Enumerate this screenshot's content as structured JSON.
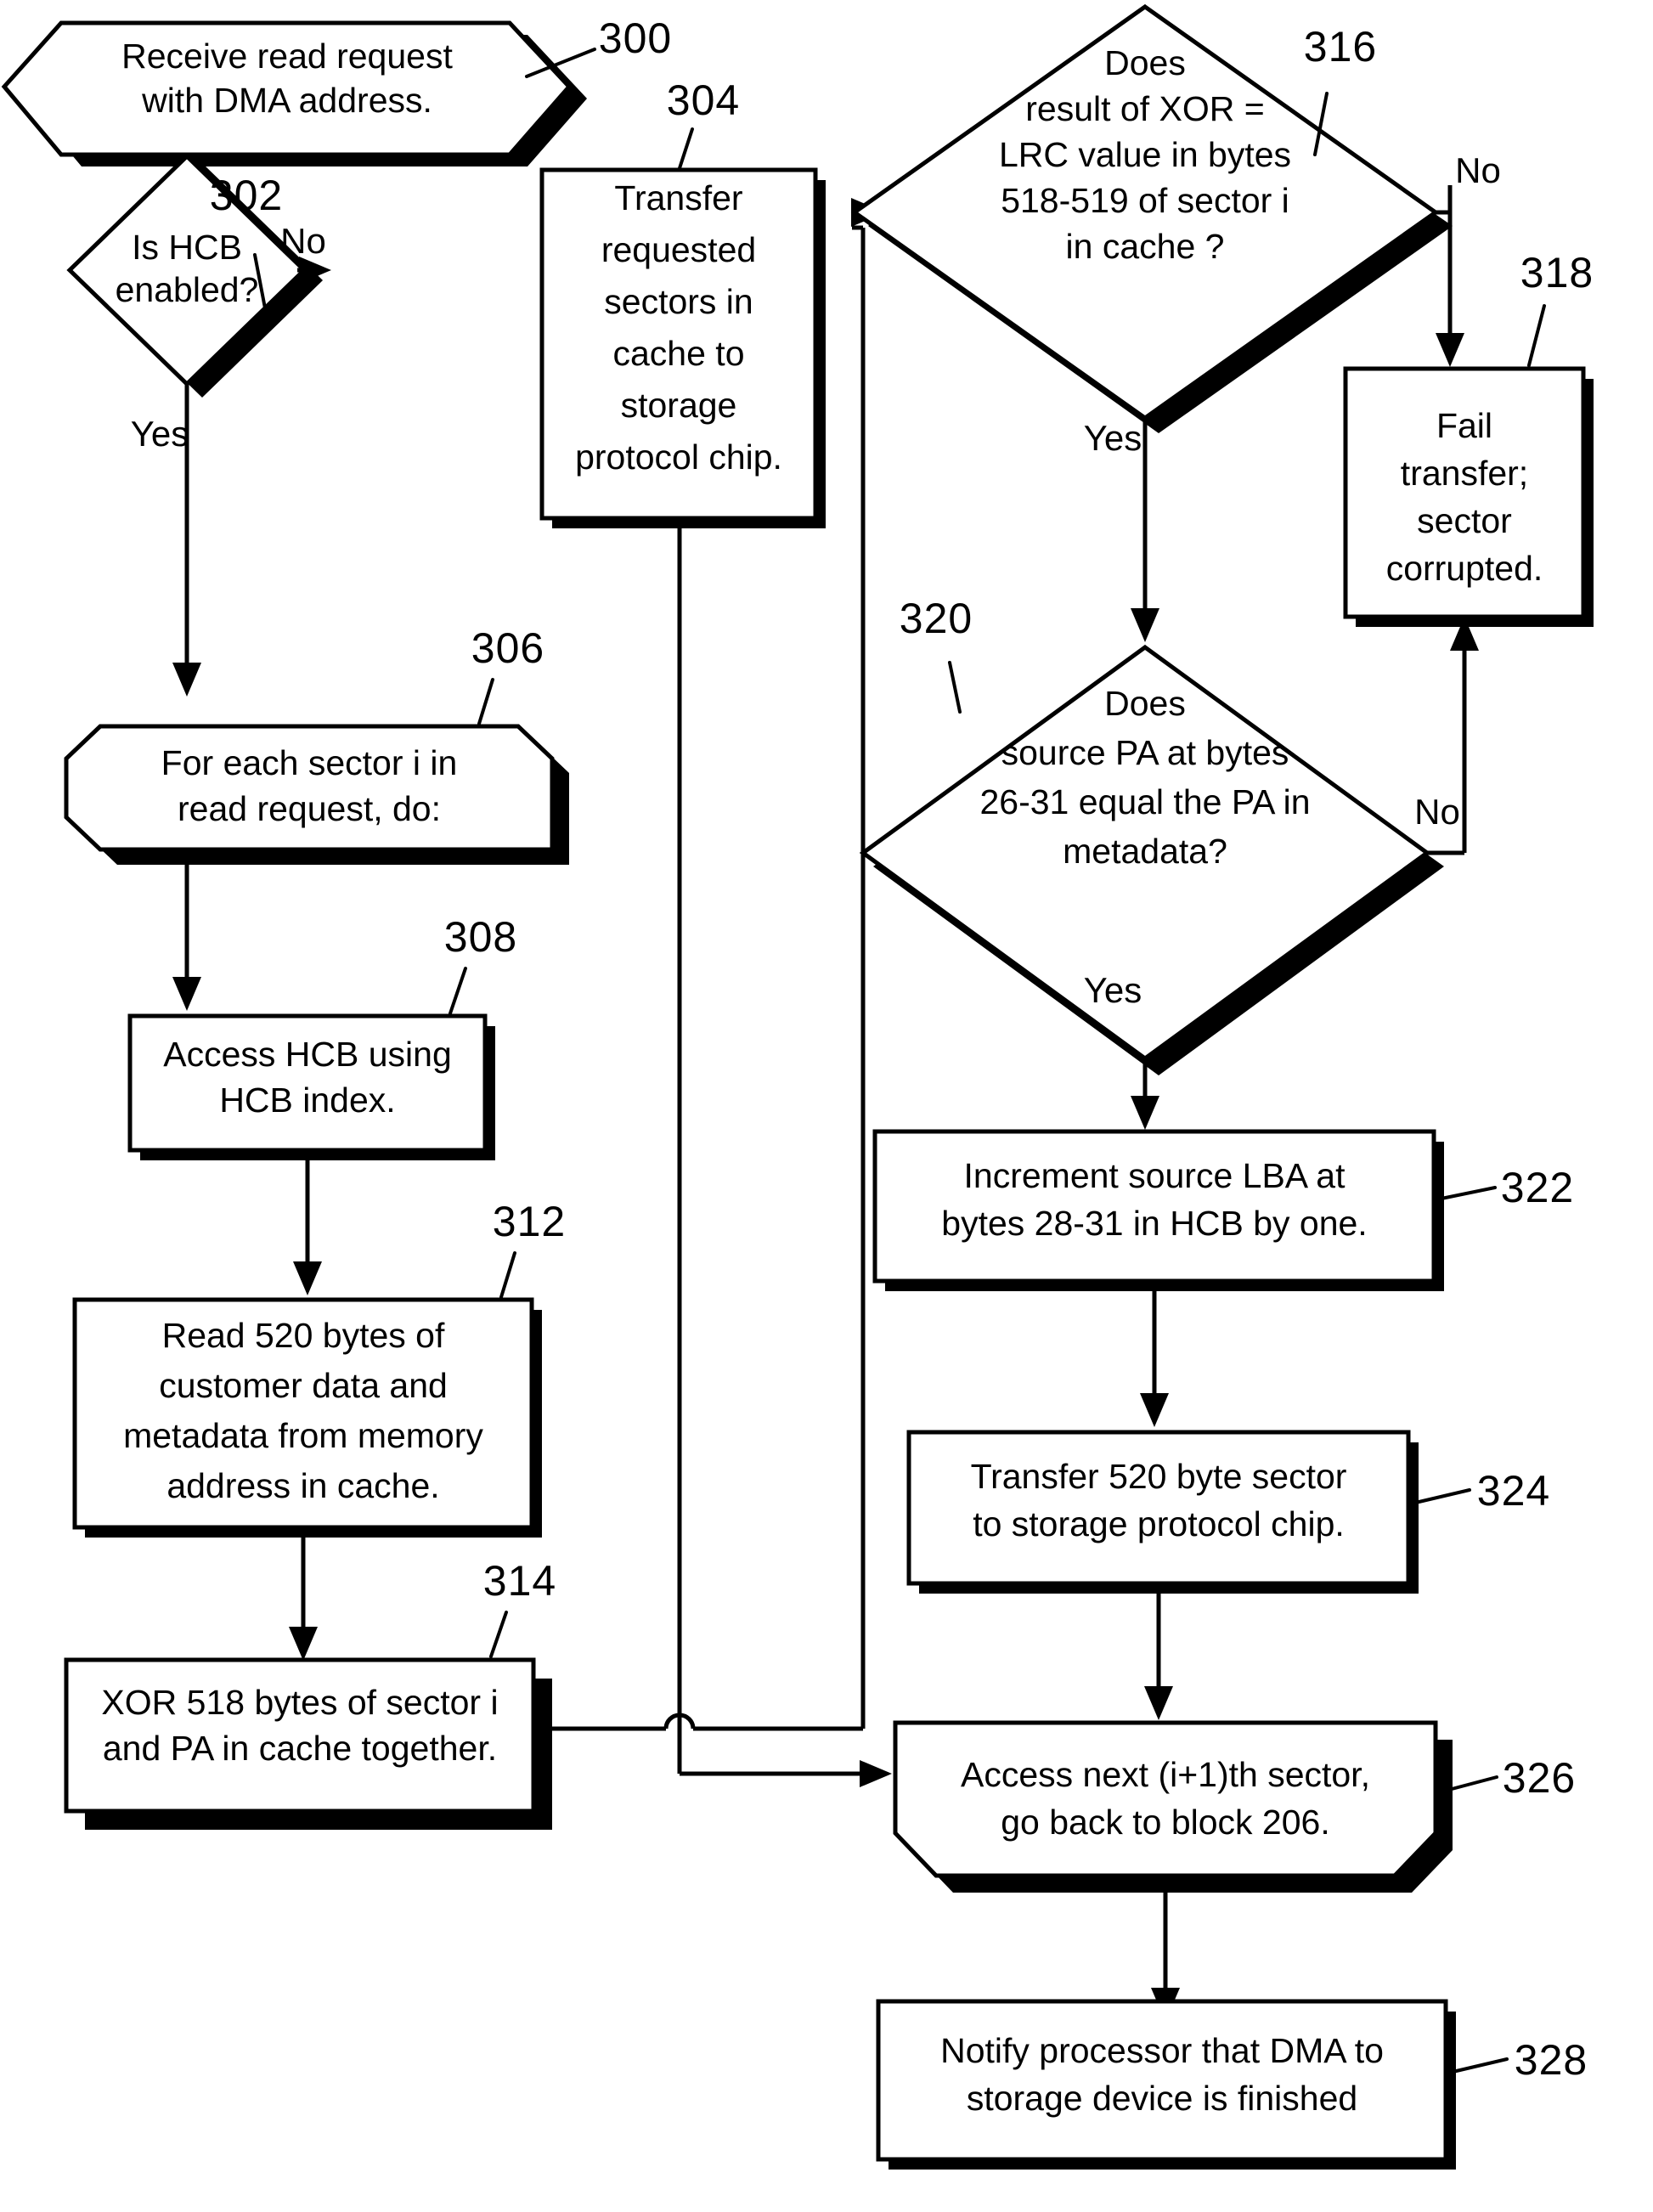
{
  "figure": {
    "type": "flowchart",
    "title": "",
    "nodes": [
      {
        "id": "300",
        "ref": "300",
        "shape": "hexagon",
        "lines": [
          "Receive read request",
          "with DMA address."
        ]
      },
      {
        "id": "302",
        "ref": "302",
        "shape": "diamond",
        "lines": [
          "Is HCB",
          "enabled?"
        ]
      },
      {
        "id": "304",
        "ref": "304",
        "shape": "rectangle",
        "lines": [
          "Transfer",
          "requested",
          "sectors in",
          "cache to",
          "storage",
          "protocol chip."
        ]
      },
      {
        "id": "306",
        "ref": "306",
        "shape": "chamfered-rectangle",
        "lines": [
          "For each sector i in",
          "read request, do:"
        ]
      },
      {
        "id": "308",
        "ref": "308",
        "shape": "rectangle",
        "lines": [
          "Access HCB using",
          "HCB index."
        ]
      },
      {
        "id": "312",
        "ref": "312",
        "shape": "rectangle",
        "lines": [
          "Read 520 bytes of",
          "customer data and",
          "metadata from memory",
          "address in cache."
        ]
      },
      {
        "id": "314",
        "ref": "314",
        "shape": "rectangle",
        "lines": [
          "XOR 518 bytes of sector i",
          "and PA in cache together."
        ]
      },
      {
        "id": "316",
        "ref": "316",
        "shape": "diamond",
        "lines": [
          "Does",
          "result of XOR =",
          "LRC value in bytes",
          "518-519 of sector i",
          "in cache ?"
        ]
      },
      {
        "id": "318",
        "ref": "318",
        "shape": "rectangle",
        "lines": [
          "Fail",
          "transfer;",
          "sector",
          "corrupted."
        ]
      },
      {
        "id": "320",
        "ref": "320",
        "shape": "diamond",
        "lines": [
          "Does",
          "source PA at bytes",
          "26-31 equal the PA in",
          "metadata?"
        ]
      },
      {
        "id": "322",
        "ref": "322",
        "shape": "rectangle",
        "lines": [
          "Increment source LBA at",
          "bytes 28-31 in HCB by one."
        ]
      },
      {
        "id": "324",
        "ref": "324",
        "shape": "rectangle",
        "lines": [
          "Transfer 520 byte sector",
          "to storage protocol chip."
        ]
      },
      {
        "id": "326",
        "ref": "326",
        "shape": "chamfered-bottom-rectangle",
        "lines": [
          "Access next (i+1)th sector,",
          "go back to block 206."
        ]
      },
      {
        "id": "328",
        "ref": "328",
        "shape": "rectangle",
        "lines": [
          "Notify processor that DMA to",
          "storage device is finished"
        ]
      }
    ],
    "edge_labels": {
      "no_302": "No",
      "yes_302": "Yes",
      "no_316": "No",
      "yes_316": "Yes",
      "no_320": "No",
      "yes_320": "Yes"
    }
  }
}
